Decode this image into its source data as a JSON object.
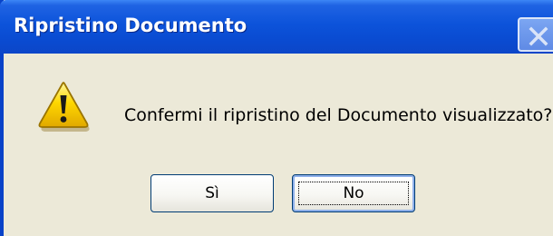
{
  "dialog": {
    "title": "Ripristino Documento",
    "message": "Confermi il ripristino del Documento visualizzato?",
    "icon": "warning-icon",
    "buttons": {
      "yes_label": "Sì",
      "no_label": "No",
      "default": "no"
    },
    "close_icon": "close-icon"
  },
  "colors": {
    "titlebar": "#0a4bd1",
    "dialog_bg": "#ece9d8",
    "button_border": "#003c74"
  }
}
